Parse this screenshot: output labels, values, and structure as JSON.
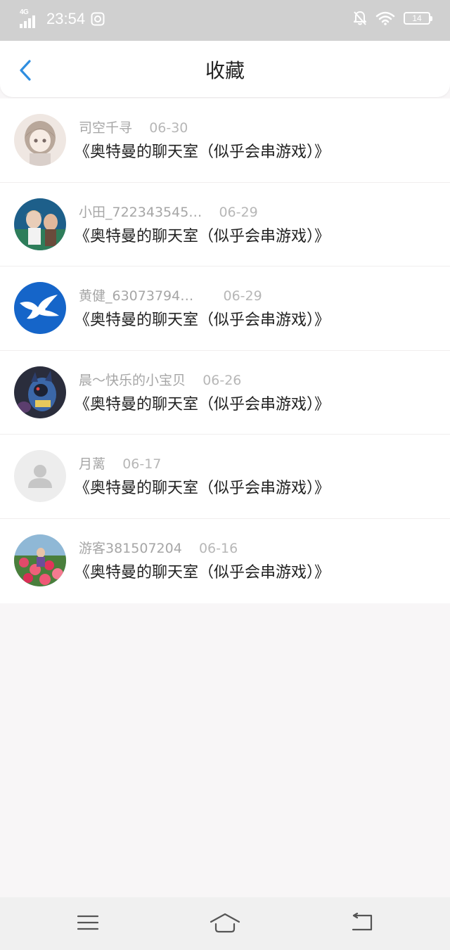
{
  "status_bar": {
    "network": "4G",
    "time": "23:54",
    "battery": "14",
    "icons": [
      "signal-icon",
      "sync-icon",
      "bell-off-icon",
      "wifi-icon",
      "battery-icon"
    ]
  },
  "nav": {
    "title": "收藏",
    "back_icon": "chevron-left-icon",
    "accent_color": "#2f8ee0"
  },
  "items": [
    {
      "user": "司空千寻",
      "date": "06-30",
      "title": "《奥特曼的聊天室（似乎会串游戏）》",
      "avatar": "anime-girl-avatar"
    },
    {
      "user": "小田_722343545…",
      "date": "06-29",
      "title": "《奥特曼的聊天室（似乎会串游戏）》",
      "avatar": "anime-characters-avatar"
    },
    {
      "user": "黄健_63073794…",
      "date": "06-29",
      "title": "《奥特曼的聊天室（似乎会串游戏）》",
      "avatar": "dove-avatar"
    },
    {
      "user": "晨～快乐的小宝贝",
      "date": "06-26",
      "title": "《奥特曼的聊天室（似乎会串游戏）》",
      "avatar": "lucario-avatar"
    },
    {
      "user": "月蓠",
      "date": "06-17",
      "title": "《奥特曼的聊天室（似乎会串游戏）》",
      "avatar": "default-user-avatar"
    },
    {
      "user": "游客381507204",
      "date": "06-16",
      "title": "《奥特曼的聊天室（似乎会串游戏）》",
      "avatar": "flowers-avatar"
    }
  ],
  "bottom_nav": {
    "icons": [
      "menu-icon",
      "home-icon",
      "back-icon"
    ]
  }
}
